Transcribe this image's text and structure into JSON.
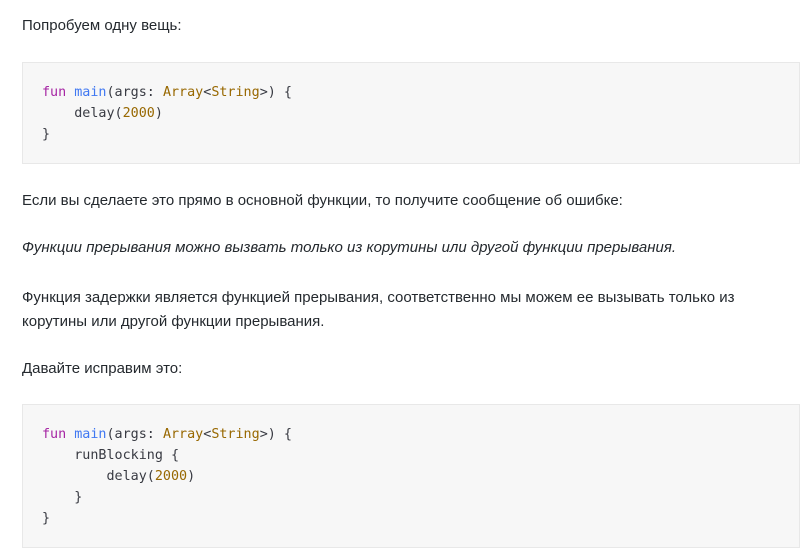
{
  "para1": "Попробуем одну вещь:",
  "code1": [
    [
      {
        "t": "fun",
        "c": "kw"
      },
      {
        "t": " "
      },
      {
        "t": "main",
        "c": "fn"
      },
      {
        "t": "(args: "
      },
      {
        "t": "Array",
        "c": "ty"
      },
      {
        "t": "<"
      },
      {
        "t": "String",
        "c": "ty"
      },
      {
        "t": ">) {"
      }
    ],
    [
      {
        "t": "    delay("
      },
      {
        "t": "2000",
        "c": "num"
      },
      {
        "t": ")"
      }
    ],
    [
      {
        "t": "}"
      }
    ]
  ],
  "para2": "Если вы сделаете это прямо в основной функции, то получите сообщение об ошибке:",
  "para3": "Функции прерывания можно вызвать только из корутины или другой функции прерывания.",
  "para4": "Функция задержки является функцией прерывания, соответственно мы можем ее вызывать только из корутины или другой функции прерывания.",
  "para5": "Давайте исправим это:",
  "code2": [
    [
      {
        "t": "fun",
        "c": "kw"
      },
      {
        "t": " "
      },
      {
        "t": "main",
        "c": "fn"
      },
      {
        "t": "(args: "
      },
      {
        "t": "Array",
        "c": "ty"
      },
      {
        "t": "<"
      },
      {
        "t": "String",
        "c": "ty"
      },
      {
        "t": ">) {"
      }
    ],
    [
      {
        "t": "    runBlocking {"
      }
    ],
    [
      {
        "t": "        delay("
      },
      {
        "t": "2000",
        "c": "num"
      },
      {
        "t": ")"
      }
    ],
    [
      {
        "t": "    }"
      }
    ],
    [
      {
        "t": "}"
      }
    ]
  ]
}
